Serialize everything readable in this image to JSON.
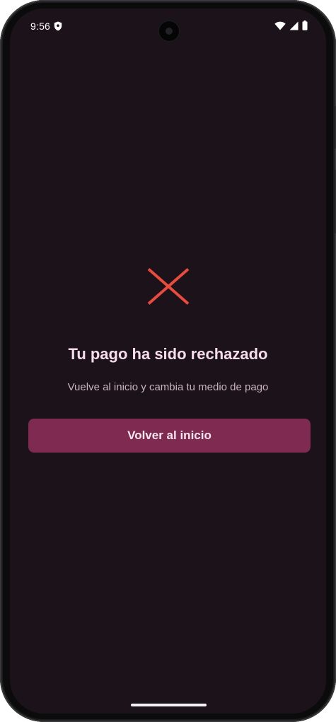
{
  "status_bar": {
    "time": "9:56",
    "icons": [
      "shield-icon",
      "wifi-icon",
      "signal-icon",
      "battery-icon"
    ]
  },
  "payment_result": {
    "icon": "close-icon",
    "icon_color": "#e94b3c",
    "title": "Tu pago ha sido rechazado",
    "subtitle": "Vuelve al inicio y cambia tu medio de pago",
    "button_label": "Volver al inicio"
  },
  "theme": {
    "background": "#1c1219",
    "button_color": "#7f2a51",
    "title_color": "#f6dcec"
  }
}
